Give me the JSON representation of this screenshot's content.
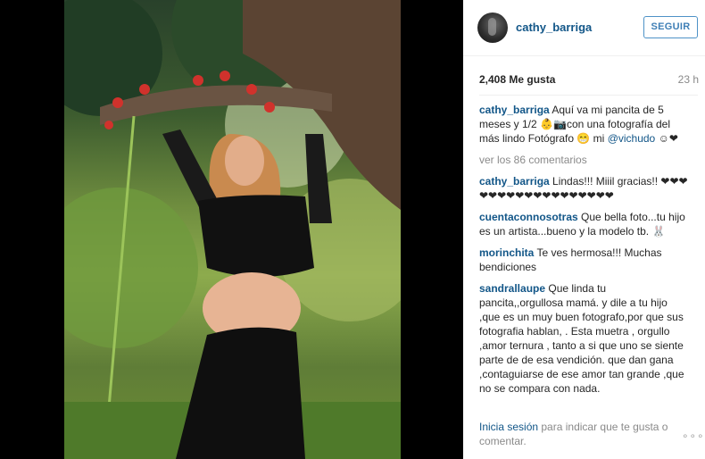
{
  "post": {
    "username": "cathy_barriga",
    "follow_label": "SEGUIR",
    "likes": "2,408 Me gusta",
    "time": "23 h",
    "caption": {
      "user": "cathy_barriga",
      "text1": "Aquí va mi pancita de 5 meses y 1/2 ",
      "text2": "con una fotografía del más lindo Fotógrafo ",
      "text3": " mi ",
      "mention": "@vichudo",
      "text4": " ☺❤"
    },
    "more_comments": "ver los 86 comentarios",
    "comments": [
      {
        "user": "cathy_barriga",
        "text": "Lindas!!! Miiil gracias!! ❤❤❤❤❤❤❤❤❤❤❤❤❤❤❤❤❤❤"
      },
      {
        "user": "cuentaconnosotras",
        "text": "Que bella foto...tu hijo es un artista...bueno y la modelo tb. 🐰"
      },
      {
        "user": "morinchita",
        "text": "Te ves hermosa!!! Muchas bendiciones"
      },
      {
        "user": "sandrallaupe",
        "text": "Que linda tu pancita,,orgullosa mamá. y dile a tu hijo ,que es un muy buen fotografo,por que sus fotografia hablan, . Esta muetra , orgullo ,amor ternura , tanto a si que uno se siente parte de de esa vendición. que dan gana ,contaguiarse de ese amor tan grande ,que no se compara con nada."
      }
    ],
    "footer": {
      "login": "Inicia sesión",
      "rest": " para indicar que te gusta o comentar."
    },
    "options": "∘∘∘"
  },
  "icons": {
    "avatar": "profile-avatar",
    "baby": "baby-emoji-icon",
    "camera": "camera-emoji-icon",
    "grin": "grin-emoji-icon",
    "options": "more-options-icon"
  },
  "colors": {
    "link": "#125688",
    "follow_border": "#4e92c7",
    "muted": "#8a8a8a"
  }
}
